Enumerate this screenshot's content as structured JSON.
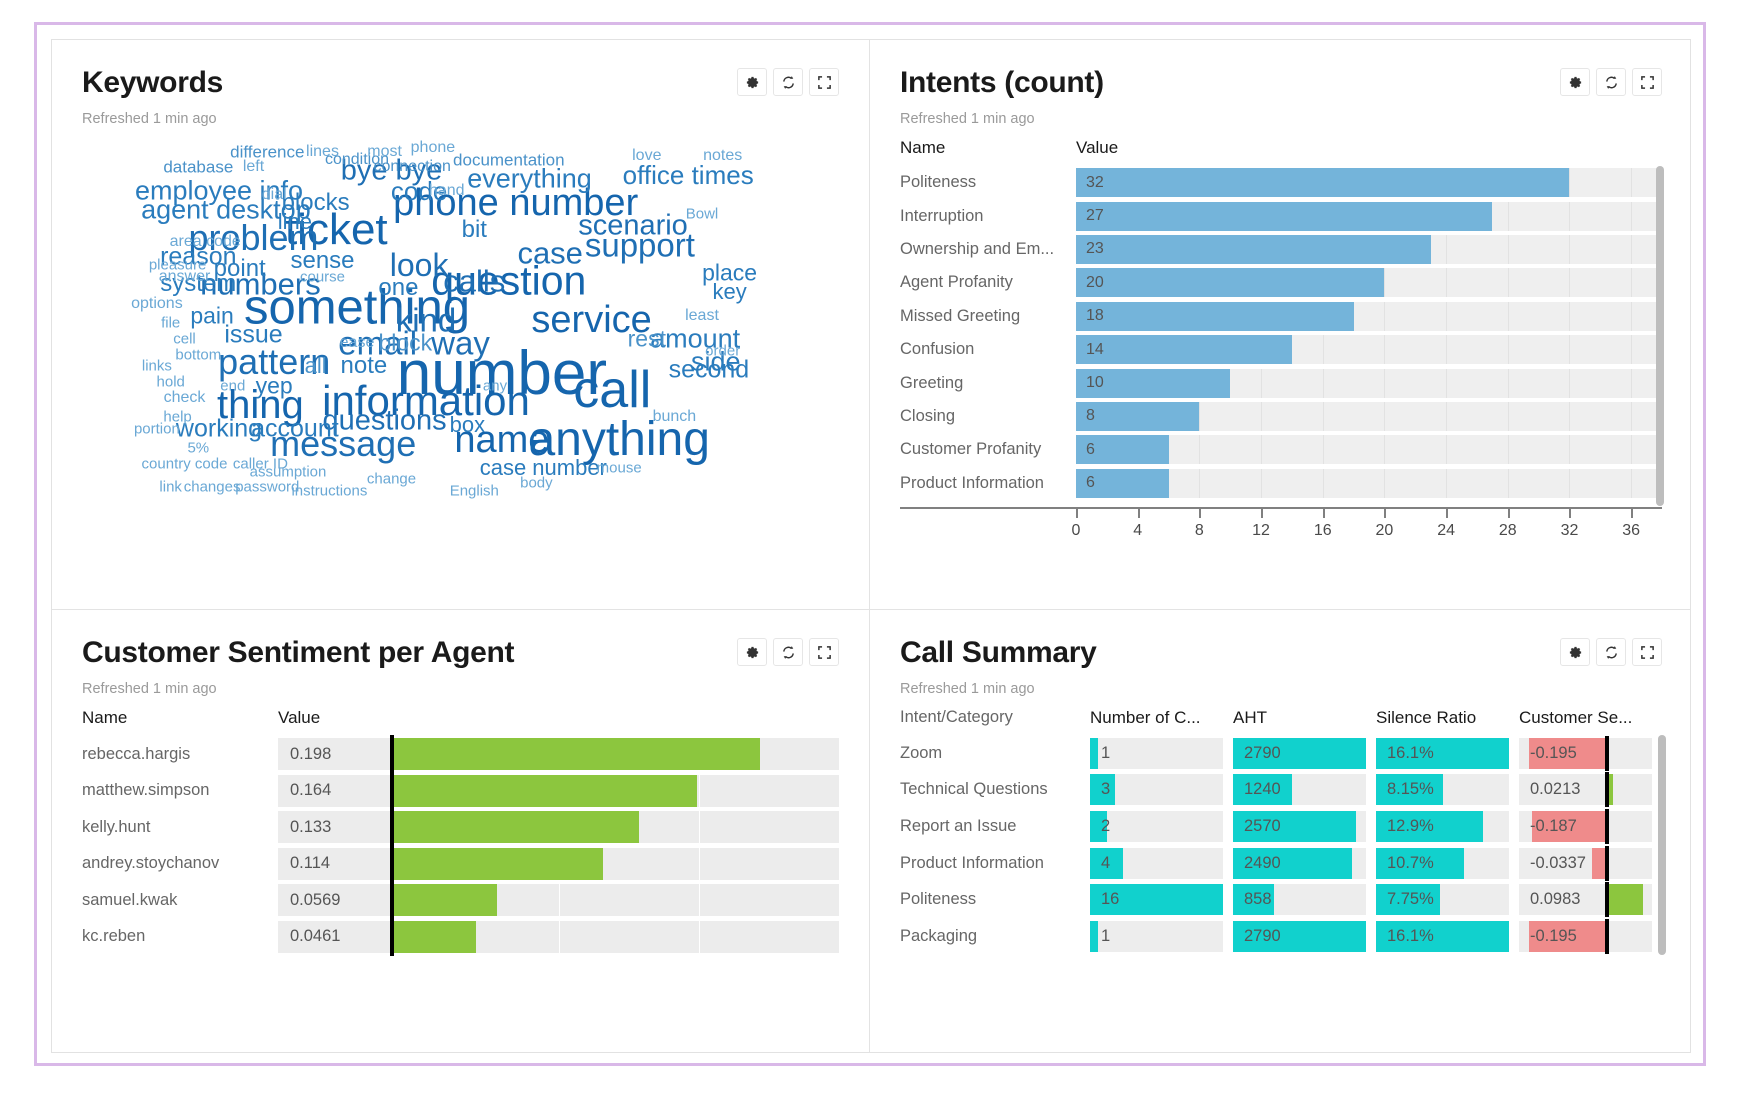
{
  "theme": {
    "blue_bar": "#74b4da",
    "green_bar": "#8cc63e",
    "cyan_bar": "#11d1cd",
    "red_bar": "#ef8b8b",
    "track": "#efefef",
    "cloud_blue": "#1f6fb4",
    "frame": "#d9b8e8"
  },
  "panels": {
    "keywords": {
      "title": "Keywords",
      "refreshed": "Refreshed 1 min ago",
      "actions": [
        "settings-icon",
        "refresh-icon",
        "expand-icon"
      ]
    },
    "intents": {
      "title": "Intents (count)",
      "refreshed": "Refreshed 1 min ago",
      "actions": [
        "settings-icon",
        "refresh-icon",
        "expand-icon"
      ],
      "columns": [
        "Name",
        "Value"
      ]
    },
    "sentiment": {
      "title": "Customer Sentiment per Agent",
      "refreshed": "Refreshed 1 min ago",
      "actions": [
        "settings-icon",
        "refresh-icon",
        "expand-icon"
      ],
      "columns": [
        "Name",
        "Value"
      ]
    },
    "callsummary": {
      "title": "Call Summary",
      "refreshed": "Refreshed 1 min ago",
      "actions": [
        "settings-icon",
        "refresh-icon",
        "expand-icon"
      ],
      "columns": [
        "Intent/Category",
        "Number of C...",
        "AHT",
        "Silence Ratio",
        "Customer Se..."
      ]
    }
  },
  "chart_data": [
    {
      "type": "wordcloud",
      "title": "Keywords",
      "words": [
        {
          "text": "number",
          "size": 62,
          "x": 56,
          "y": 59,
          "color": "#1565ad"
        },
        {
          "text": "something",
          "size": 49,
          "x": 35,
          "y": 42,
          "color": "#1565ad"
        },
        {
          "text": "anything",
          "size": 48,
          "x": 73,
          "y": 76,
          "color": "#1565ad"
        },
        {
          "text": "call",
          "size": 52,
          "x": 72,
          "y": 63,
          "color": "#1565ad"
        },
        {
          "text": "ticket",
          "size": 44,
          "x": 32,
          "y": 22,
          "color": "#1565ad"
        },
        {
          "text": "information",
          "size": 42,
          "x": 45,
          "y": 66,
          "color": "#1565ad"
        },
        {
          "text": "question",
          "size": 41,
          "x": 57,
          "y": 35,
          "color": "#1565ad"
        },
        {
          "text": "phone number",
          "size": 38,
          "x": 58,
          "y": 15,
          "color": "#1565ad"
        },
        {
          "text": "thing",
          "size": 40,
          "x": 21,
          "y": 67,
          "color": "#1565ad"
        },
        {
          "text": "service",
          "size": 38,
          "x": 69,
          "y": 45,
          "color": "#1565ad"
        },
        {
          "text": "problem",
          "size": 36,
          "x": 20,
          "y": 24,
          "color": "#1f6fb4"
        },
        {
          "text": "pattern",
          "size": 36,
          "x": 23,
          "y": 56,
          "color": "#1f6fb4"
        },
        {
          "text": "name",
          "size": 38,
          "x": 56,
          "y": 76,
          "color": "#1565ad"
        },
        {
          "text": "message",
          "size": 36,
          "x": 33,
          "y": 77,
          "color": "#1f6fb4"
        },
        {
          "text": "support",
          "size": 33,
          "x": 76,
          "y": 26,
          "color": "#1f6fb4"
        },
        {
          "text": "email",
          "size": 33,
          "x": 38,
          "y": 51,
          "color": "#1f6fb4"
        },
        {
          "text": "numbers",
          "size": 31,
          "x": 21,
          "y": 36,
          "color": "#1f6fb4"
        },
        {
          "text": "kind",
          "size": 33,
          "x": 45,
          "y": 45,
          "color": "#1f6fb4"
        },
        {
          "text": "way",
          "size": 33,
          "x": 50,
          "y": 51,
          "color": "#1f6fb4"
        },
        {
          "text": "look",
          "size": 32,
          "x": 44,
          "y": 31,
          "color": "#1f6fb4"
        },
        {
          "text": "calls",
          "size": 31,
          "x": 52,
          "y": 35,
          "color": "#1f6fb4"
        },
        {
          "text": "case",
          "size": 31,
          "x": 63,
          "y": 28,
          "color": "#1f6fb4"
        },
        {
          "text": "questions",
          "size": 29,
          "x": 39,
          "y": 71,
          "color": "#1f6fb4"
        },
        {
          "text": "scenario",
          "size": 29,
          "x": 75,
          "y": 21,
          "color": "#1f6fb4"
        },
        {
          "text": "everything",
          "size": 27,
          "x": 60,
          "y": 9,
          "color": "#2a7cbd"
        },
        {
          "text": "bye bye",
          "size": 29,
          "x": 40,
          "y": 7,
          "color": "#1f6fb4"
        },
        {
          "text": "employee info",
          "size": 27,
          "x": 15,
          "y": 12,
          "color": "#2a7cbd"
        },
        {
          "text": "agent desktop",
          "size": 27,
          "x": 16,
          "y": 17,
          "color": "#2a7cbd"
        },
        {
          "text": "second",
          "size": 25,
          "x": 86,
          "y": 58,
          "color": "#2a7cbd"
        },
        {
          "text": "amount",
          "size": 27,
          "x": 84,
          "y": 50,
          "color": "#2a7cbd"
        },
        {
          "text": "side",
          "size": 27,
          "x": 87,
          "y": 56,
          "color": "#2a7cbd"
        },
        {
          "text": "office times",
          "size": 26,
          "x": 83,
          "y": 8,
          "color": "#2a7cbd"
        },
        {
          "text": "code",
          "size": 26,
          "x": 44,
          "y": 12,
          "color": "#2a7cbd"
        },
        {
          "text": "case number",
          "size": 22,
          "x": 62,
          "y": 83,
          "color": "#2a7cbd"
        },
        {
          "text": "reason",
          "size": 25,
          "x": 12,
          "y": 29,
          "color": "#2a7cbd"
        },
        {
          "text": "account",
          "size": 25,
          "x": 26,
          "y": 73,
          "color": "#2a7cbd"
        },
        {
          "text": "working",
          "size": 25,
          "x": 15,
          "y": 73,
          "color": "#2a7cbd"
        },
        {
          "text": "issue",
          "size": 25,
          "x": 20,
          "y": 49,
          "color": "#2a7cbd"
        },
        {
          "text": "point",
          "size": 24,
          "x": 18,
          "y": 32,
          "color": "#2a7cbd"
        },
        {
          "text": "sense",
          "size": 24,
          "x": 30,
          "y": 30,
          "color": "#2a7cbd"
        },
        {
          "text": "system",
          "size": 24,
          "x": 12,
          "y": 36,
          "color": "#2a7cbd"
        },
        {
          "text": "blocks",
          "size": 24,
          "x": 29,
          "y": 15,
          "color": "#2a7cbd"
        },
        {
          "text": "block",
          "size": 23,
          "x": 42,
          "y": 51,
          "color": "#4a92c9"
        },
        {
          "text": "place",
          "size": 23,
          "x": 89,
          "y": 33,
          "color": "#2a7cbd"
        },
        {
          "text": "one",
          "size": 24,
          "x": 41,
          "y": 37,
          "color": "#2a7cbd"
        },
        {
          "text": "note",
          "size": 24,
          "x": 36,
          "y": 57,
          "color": "#2a7cbd"
        },
        {
          "text": "all",
          "size": 22,
          "x": 29,
          "y": 57,
          "color": "#4a92c9"
        },
        {
          "text": "bit",
          "size": 24,
          "x": 52,
          "y": 22,
          "color": "#2a7cbd"
        },
        {
          "text": "rest",
          "size": 23,
          "x": 77,
          "y": 50,
          "color": "#4a92c9"
        },
        {
          "text": "box",
          "size": 22,
          "x": 51,
          "y": 72,
          "color": "#2a7cbd"
        },
        {
          "text": "yep",
          "size": 23,
          "x": 23,
          "y": 62,
          "color": "#2a7cbd"
        },
        {
          "text": "pain",
          "size": 23,
          "x": 14,
          "y": 44,
          "color": "#2a7cbd"
        },
        {
          "text": "line",
          "size": 22,
          "x": 26,
          "y": 20,
          "color": "#2a7cbd"
        },
        {
          "text": "key",
          "size": 22,
          "x": 89,
          "y": 38,
          "color": "#2a7cbd"
        },
        {
          "text": "documentation",
          "size": 17,
          "x": 57,
          "y": 4,
          "color": "#4a92c9"
        },
        {
          "text": "connection",
          "size": 16,
          "x": 43,
          "y": 6,
          "color": "#4a92c9"
        },
        {
          "text": "condition",
          "size": 16,
          "x": 35,
          "y": 4,
          "color": "#4a92c9"
        },
        {
          "text": "difference",
          "size": 17,
          "x": 22,
          "y": 2,
          "color": "#4a92c9"
        },
        {
          "text": "database",
          "size": 17,
          "x": 12,
          "y": 6,
          "color": "#4a92c9"
        },
        {
          "text": "area code",
          "size": 16,
          "x": 13,
          "y": 25,
          "color": "#6aa8d5"
        },
        {
          "text": "country code",
          "size": 15,
          "x": 10,
          "y": 82,
          "color": "#6aa8d5"
        },
        {
          "text": "caller ID",
          "size": 15,
          "x": 21,
          "y": 82,
          "color": "#6aa8d5"
        },
        {
          "text": "instructions",
          "size": 15,
          "x": 31,
          "y": 89,
          "color": "#6aa8d5"
        },
        {
          "text": "password",
          "size": 15,
          "x": 22,
          "y": 88,
          "color": "#6aa8d5"
        },
        {
          "text": "assumption",
          "size": 15,
          "x": 25,
          "y": 84,
          "color": "#6aa8d5"
        },
        {
          "text": "changes",
          "size": 15,
          "x": 14,
          "y": 88,
          "color": "#6aa8d5"
        },
        {
          "text": "change",
          "size": 15,
          "x": 40,
          "y": 86,
          "color": "#6aa8d5"
        },
        {
          "text": "English",
          "size": 15,
          "x": 52,
          "y": 89,
          "color": "#6aa8d5"
        },
        {
          "text": "body",
          "size": 15,
          "x": 61,
          "y": 87,
          "color": "#6aa8d5"
        },
        {
          "text": "mouse",
          "size": 15,
          "x": 73,
          "y": 83,
          "color": "#6aa8d5"
        },
        {
          "text": "bunch",
          "size": 16,
          "x": 81,
          "y": 70,
          "color": "#6aa8d5"
        },
        {
          "text": "least",
          "size": 16,
          "x": 85,
          "y": 44,
          "color": "#6aa8d5"
        },
        {
          "text": "order",
          "size": 15,
          "x": 88,
          "y": 53,
          "color": "#6aa8d5"
        },
        {
          "text": "any",
          "size": 15,
          "x": 55,
          "y": 62,
          "color": "#6aa8d5"
        },
        {
          "text": "ease",
          "size": 16,
          "x": 35,
          "y": 51,
          "color": "#6aa8d5"
        },
        {
          "text": "Bowl",
          "size": 15,
          "x": 85,
          "y": 18,
          "color": "#6aa8d5"
        },
        {
          "text": "love",
          "size": 16,
          "x": 77,
          "y": 3,
          "color": "#6aa8d5"
        },
        {
          "text": "notes",
          "size": 16,
          "x": 88,
          "y": 3,
          "color": "#6aa8d5"
        },
        {
          "text": "most",
          "size": 16,
          "x": 39,
          "y": 2,
          "color": "#6aa8d5"
        },
        {
          "text": "phone",
          "size": 16,
          "x": 46,
          "y": 1,
          "color": "#6aa8d5"
        },
        {
          "text": "lines",
          "size": 16,
          "x": 30,
          "y": 2,
          "color": "#6aa8d5"
        },
        {
          "text": "left",
          "size": 16,
          "x": 20,
          "y": 6,
          "color": "#6aa8d5"
        },
        {
          "text": "dial",
          "size": 16,
          "x": 23,
          "y": 13,
          "color": "#6aa8d5"
        },
        {
          "text": "hand",
          "size": 16,
          "x": 48,
          "y": 12,
          "color": "#6aa8d5"
        },
        {
          "text": "pleasure",
          "size": 15,
          "x": 9,
          "y": 31,
          "color": "#6aa8d5"
        },
        {
          "text": "answer",
          "size": 16,
          "x": 10,
          "y": 34,
          "color": "#6aa8d5"
        },
        {
          "text": "course",
          "size": 15,
          "x": 30,
          "y": 34,
          "color": "#6aa8d5"
        },
        {
          "text": "options",
          "size": 16,
          "x": 6,
          "y": 41,
          "color": "#6aa8d5"
        },
        {
          "text": "file",
          "size": 15,
          "x": 8,
          "y": 46,
          "color": "#6aa8d5"
        },
        {
          "text": "cell",
          "size": 15,
          "x": 10,
          "y": 50,
          "color": "#6aa8d5"
        },
        {
          "text": "bottom",
          "size": 15,
          "x": 12,
          "y": 54,
          "color": "#6aa8d5"
        },
        {
          "text": "links",
          "size": 15,
          "x": 6,
          "y": 57,
          "color": "#6aa8d5"
        },
        {
          "text": "hold",
          "size": 15,
          "x": 8,
          "y": 61,
          "color": "#6aa8d5"
        },
        {
          "text": "check",
          "size": 16,
          "x": 10,
          "y": 65,
          "color": "#6aa8d5"
        },
        {
          "text": "end",
          "size": 15,
          "x": 17,
          "y": 62,
          "color": "#6aa8d5"
        },
        {
          "text": "help",
          "size": 15,
          "x": 9,
          "y": 70,
          "color": "#6aa8d5"
        },
        {
          "text": "portion",
          "size": 15,
          "x": 6,
          "y": 73,
          "color": "#6aa8d5"
        },
        {
          "text": "5%",
          "size": 15,
          "x": 12,
          "y": 78,
          "color": "#6aa8d5"
        },
        {
          "text": "link",
          "size": 15,
          "x": 8,
          "y": 88,
          "color": "#6aa8d5"
        }
      ]
    },
    {
      "type": "bar",
      "orientation": "horizontal",
      "title": "Intents (count)",
      "xlabel": "",
      "ylabel": "",
      "xlim": [
        0,
        38
      ],
      "ticks": [
        0,
        4,
        8,
        12,
        16,
        20,
        24,
        28,
        32,
        36
      ],
      "grid": true,
      "categories": [
        "Politeness",
        "Interruption",
        "Ownership and Em...",
        "Agent Profanity",
        "Missed Greeting",
        "Confusion",
        "Greeting",
        "Closing",
        "Customer Profanity",
        "Product Information"
      ],
      "values": [
        32,
        27,
        23,
        20,
        18,
        14,
        10,
        8,
        6,
        6
      ],
      "value_labels": [
        "32",
        "27",
        "23",
        "20",
        "18",
        "14",
        "10",
        "8",
        "6",
        "6"
      ]
    },
    {
      "type": "bar",
      "orientation": "horizontal",
      "title": "Customer Sentiment per Agent",
      "xlim": [
        -0.06,
        0.24
      ],
      "zero_at_pct": 50,
      "grid": true,
      "categories": [
        "rebecca.hargis",
        "matthew.simpson",
        "kelly.hunt",
        "andrey.stoychanov",
        "samuel.kwak",
        "kc.reben"
      ],
      "values": [
        0.198,
        0.164,
        0.133,
        0.114,
        0.0569,
        0.0461
      ],
      "value_labels": [
        "0.198",
        "0.164",
        "0.133",
        "0.114",
        "0.0569",
        "0.0461"
      ]
    },
    {
      "type": "table",
      "title": "Call Summary",
      "columns": [
        "Intent/Category",
        "Number of C...",
        "AHT",
        "Silence Ratio",
        "Customer Se..."
      ],
      "rows": [
        {
          "category": "Zoom",
          "calls": "1",
          "calls_n": 1,
          "aht": "2790",
          "aht_n": 2790,
          "silence": "16.1%",
          "silence_n": 16.1,
          "sentiment": "-0.195",
          "sentiment_n": -0.195
        },
        {
          "category": "Technical Questions",
          "calls": "3",
          "calls_n": 3,
          "aht": "1240",
          "aht_n": 1240,
          "silence": "8.15%",
          "silence_n": 8.15,
          "sentiment": "0.0213",
          "sentiment_n": 0.0213
        },
        {
          "category": "Report an Issue",
          "calls": "2",
          "calls_n": 2,
          "aht": "2570",
          "aht_n": 2570,
          "silence": "12.9%",
          "silence_n": 12.9,
          "sentiment": "-0.187",
          "sentiment_n": -0.187
        },
        {
          "category": "Product Information",
          "calls": "4",
          "calls_n": 4,
          "aht": "2490",
          "aht_n": 2490,
          "silence": "10.7%",
          "silence_n": 10.7,
          "sentiment": "-0.0337",
          "sentiment_n": -0.0337
        },
        {
          "category": "Politeness",
          "calls": "16",
          "calls_n": 16,
          "aht": "858",
          "aht_n": 858,
          "silence": "7.75%",
          "silence_n": 7.75,
          "sentiment": "0.0983",
          "sentiment_n": 0.0983
        },
        {
          "category": "Packaging",
          "calls": "1",
          "calls_n": 1,
          "aht": "2790",
          "aht_n": 2790,
          "silence": "16.1%",
          "silence_n": 16.1,
          "sentiment": "-0.195",
          "sentiment_n": -0.195
        }
      ]
    }
  ]
}
